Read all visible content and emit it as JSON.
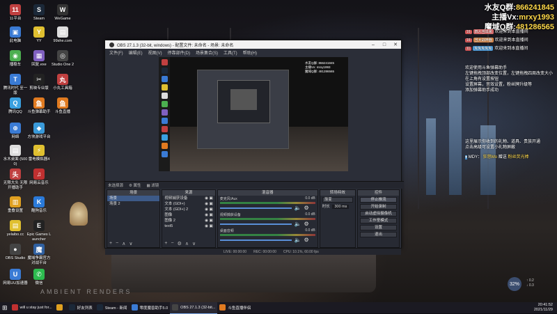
{
  "overlay": {
    "line1_label": "水友Q群:",
    "line1_value": "866241845",
    "line2_label": "主播Vx:",
    "line2_value": "mrxy1993",
    "line3_label": "魔域Q群:",
    "line3_value": "481286565"
  },
  "chat": [
    {
      "badge": "16",
      "tag": "四人当出来",
      "tag_color": "#e06f6f",
      "text": "欢迎来到本直播间"
    },
    {
      "badge": "16",
      "tag": "当大战神器",
      "tag_color": "#e08f4f",
      "text": "欢迎来到本直播间"
    },
    {
      "badge": "11",
      "tag": "免免免免免",
      "tag_color": "#4fa0e0",
      "text": "欢迎来到本直播间"
    }
  ],
  "notice1": {
    "l1": "欢迎使用斗鱼弹幕助手",
    "l2": "左键拖拽顶部改变位置，左键拖拽四周改变大小",
    "l3": "在上角有设置按钮",
    "l4": "设置屏幕，音效设置，粉丝牌升级等",
    "l5": "添加弹幕助手成功"
  },
  "notice2": {
    "l1": "这里展示你收到的礼物、道具、贵族开通",
    "l2": "点击高级可设置小礼物屏蔽",
    "gift_user": "MDY：",
    "gift_name": "狂怒Mo",
    "gift_action": "赠送",
    "gift_item": "粉丝荧光棒"
  },
  "desktop_icons": [
    {
      "label": "11平台",
      "color": "#c04040",
      "glyph": "11"
    },
    {
      "label": "Steam",
      "color": "#1b2838",
      "glyph": "S"
    },
    {
      "label": "WeGame",
      "color": "#333",
      "glyph": "W"
    },
    {
      "label": "此电脑",
      "color": "#3a7bd5",
      "glyph": "▣"
    },
    {
      "label": "YY",
      "color": "#e0c030",
      "glyph": "Y"
    },
    {
      "label": "99she.com",
      "color": "#ddd",
      "glyph": "▤"
    },
    {
      "label": "播稳车",
      "color": "#4caf50",
      "glyph": "◉"
    },
    {
      "label": "回复.exe",
      "color": "#8060c0",
      "glyph": "▦"
    },
    {
      "label": "Studio One 2",
      "color": "#444",
      "glyph": "◎"
    },
    {
      "label": "腾讯时代 至一版",
      "color": "#3a7bd5",
      "glyph": "T"
    },
    {
      "label": "剪映专业版",
      "color": "#222",
      "glyph": "✂"
    },
    {
      "label": "小丸工具箱",
      "color": "#c04040",
      "glyph": "丸"
    },
    {
      "label": "腾讯QQ",
      "color": "#3aa0e0",
      "glyph": "Q"
    },
    {
      "label": "斗鱼弹幕助手",
      "color": "#e07a20",
      "glyph": "鱼"
    },
    {
      "label": "斗鱼直播",
      "color": "#e07a20",
      "glyph": "鱼"
    },
    {
      "label": "网络",
      "color": "#3a7bd5",
      "glyph": "⊕"
    },
    {
      "label": "方块游戏平台",
      "color": "#3a9ad9",
      "glyph": "◆"
    },
    {
      "label": "水木桌面 (5000)",
      "color": "#ddd",
      "glyph": "▤"
    },
    {
      "label": "雷电模拟器4",
      "color": "#e0c030",
      "glyph": "⚡"
    },
    {
      "label": "无限大头 无限开播助手",
      "color": "#c04040",
      "glyph": "头"
    },
    {
      "label": "网易云音乐",
      "color": "#c03030",
      "glyph": "♫"
    },
    {
      "label": "重叠设置",
      "color": "#e0a020",
      "glyph": "▥"
    },
    {
      "label": "酷狗音乐",
      "color": "#2a7ad9",
      "glyph": "K"
    },
    {
      "label": "yelaibo.cc",
      "color": "#e0c030",
      "glyph": "▤"
    },
    {
      "label": "Epic Games Launcher",
      "color": "#222",
      "glyph": "E"
    },
    {
      "label": "OBS Studio",
      "color": "#444",
      "glyph": "●"
    },
    {
      "label": "魔域争霸官方对战平台",
      "color": "#3060a0",
      "glyph": "魔"
    },
    {
      "label": "网易UU加速器",
      "color": "#3a7bd5",
      "glyph": "U"
    },
    {
      "label": "微信",
      "color": "#2dbb4f",
      "glyph": "✆"
    }
  ],
  "obs": {
    "title": "OBS 27.1.3 (32-bit, windows) - 配置文件: 未命名 - 场景: 未命名",
    "menu": [
      "文件(F)",
      "编辑(E)",
      "视图(V)",
      "停靠部件(D)",
      "场景集合(S)",
      "工具(T)",
      "帮助(H)"
    ],
    "scene_bar_label": "未选择源",
    "scene_bar_props": "属性",
    "scene_bar_filters": "滤镜",
    "docks": {
      "scenes": "场景",
      "sources": "来源",
      "mixer": "混音器",
      "transitions": "转场特效",
      "controls": "控件"
    },
    "scene_items": [
      "场景",
      "场景 2"
    ],
    "source_items": [
      "视频捕获设备",
      "文本 (GDI+)",
      "文本 (GDI+) 2",
      "图像",
      "图像 2",
      "text5"
    ],
    "mixer_channels": [
      {
        "name": "麦克风/Aux",
        "db": "0.0 dB"
      },
      {
        "name": "视频捕获设备",
        "db": "0.0 dB"
      },
      {
        "name": "桌面音频",
        "db": "0.0 dB"
      }
    ],
    "transition_type": "渐变",
    "transition_label": "时长",
    "transition_duration": "300 ms",
    "controls": [
      "停止推流",
      "开始录制",
      "启动虚拟摄像机",
      "工作室模式",
      "设置",
      "退出"
    ],
    "status": {
      "live_label": "LIVE:",
      "live_time": "00:00:00",
      "rec_label": "REC:",
      "rec_time": "00:00:00",
      "cpu": "CPU: 10.1%, 60.00 fps"
    },
    "preview_text": [
      "水友Q群: 866241845",
      "主播Vx: mrxy1993",
      "魔域Q群: 481286565"
    ]
  },
  "taskbar": [
    {
      "label": "will u stay just for...",
      "color": "#c03030"
    },
    {
      "label": "",
      "color": "#e0a020"
    },
    {
      "label": "好友列表",
      "color": "#1b2838"
    },
    {
      "label": "Steam - 新闻",
      "color": "#1b2838"
    },
    {
      "label": "零度魔兽助手5.0",
      "color": "#3a7bd5"
    },
    {
      "label": "OBS 27.1.3 (32-bit...",
      "color": "#444"
    },
    {
      "label": "斗鱼直播伴侣",
      "color": "#e07a20"
    }
  ],
  "tray": {
    "time": "20:41:52",
    "date": "2021/11/29"
  },
  "widget": {
    "percent": "32",
    "up": "0.2",
    "down": "0.3"
  },
  "watermark": "AMBIENT RENDERS"
}
